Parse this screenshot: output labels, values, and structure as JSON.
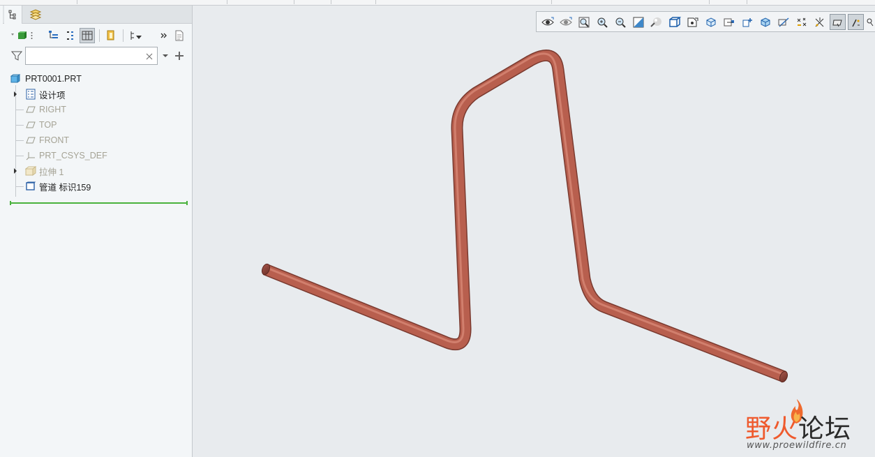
{
  "navigator": {
    "tabs": [
      {
        "name": "model-tree-tab",
        "icon": "model-tree-icon"
      },
      {
        "name": "layers-tab",
        "icon": "layers-icon"
      }
    ],
    "toolbar": {
      "icons": [
        "show-part-icon",
        "settings-icon",
        "tree-filters-icon",
        "tree-columns-icon",
        "grid-view-icon",
        "suppressed-icon",
        "sort-icon",
        "more-icon",
        "notes-icon"
      ]
    },
    "search": {
      "placeholder": "",
      "value": "",
      "icons": [
        "filter-icon",
        "clear-icon",
        "dropdown-icon",
        "add-icon"
      ]
    },
    "tree": {
      "root": {
        "label": "PRT0001.PRT",
        "icon": "part-icon"
      },
      "items": [
        {
          "label": "设计项",
          "icon": "design-items-icon",
          "dim": false,
          "expandable": true
        },
        {
          "label": "RIGHT",
          "icon": "datum-plane-icon",
          "dim": true,
          "expandable": false
        },
        {
          "label": "TOP",
          "icon": "datum-plane-icon",
          "dim": true,
          "expandable": false
        },
        {
          "label": "FRONT",
          "icon": "datum-plane-icon",
          "dim": true,
          "expandable": false
        },
        {
          "label": "PRT_CSYS_DEF",
          "icon": "coordinate-system-icon",
          "dim": true,
          "expandable": false
        },
        {
          "label": "拉伸 1",
          "icon": "extrude-icon",
          "dim": true,
          "expandable": true
        },
        {
          "label": "管道 标识159",
          "icon": "pipe-feature-icon",
          "dim": false,
          "expandable": false
        }
      ]
    }
  },
  "view_toolbar": {
    "buttons": [
      "saved-views-icon",
      "appearance-icon",
      "refit-icon",
      "zoom-in-icon",
      "zoom-out-icon",
      "repaint-icon",
      "display-style-icon",
      "named-views-icon",
      "section-icon",
      "orient-icon",
      "perspective-icon",
      "annotation-display-icon",
      "plane-display-icon",
      "axis-display-icon",
      "point-display-icon",
      "csys-display-icon",
      "spin-center-icon",
      "annotation-orientation-icon",
      "edge-display-icon"
    ],
    "pressed": [
      17,
      18
    ]
  },
  "model": {
    "pipe_color": "#b85f4e",
    "pipe_highlight": "#d98a78",
    "pipe_end_color": "#8c4538"
  },
  "watermark": {
    "title_part1": "野火",
    "title_part2": "论坛",
    "url": "www.proewildfire.cn"
  }
}
